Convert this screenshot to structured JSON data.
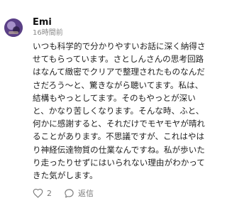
{
  "comment": {
    "username": "Emi",
    "timestamp": "16時間前",
    "body": "いつも科学的で分かりやすいお話に深く納得させてもらっています。さとしんさんの思考回路はなんて緻密でクリアで整理されたものなんださだろう〜と、驚きながら聴いてます。私は、結構もやっとしてます。そのもやっとが深いと、かなり苦しくなります。そんな時、ふと、何かに感謝すると、それだけでモヤモヤが晴れることがあります。不思議ですが、これはやはり神経伝達物質の仕業なんですね。私が歩いたり走ったりせずにはいられない理由がわかってきた気がします。",
    "likes": "2",
    "reply_label": "返信"
  },
  "icons": {
    "like": "heart-icon",
    "reply": "chat-bubble-icon",
    "avatar": "avatar-image"
  }
}
